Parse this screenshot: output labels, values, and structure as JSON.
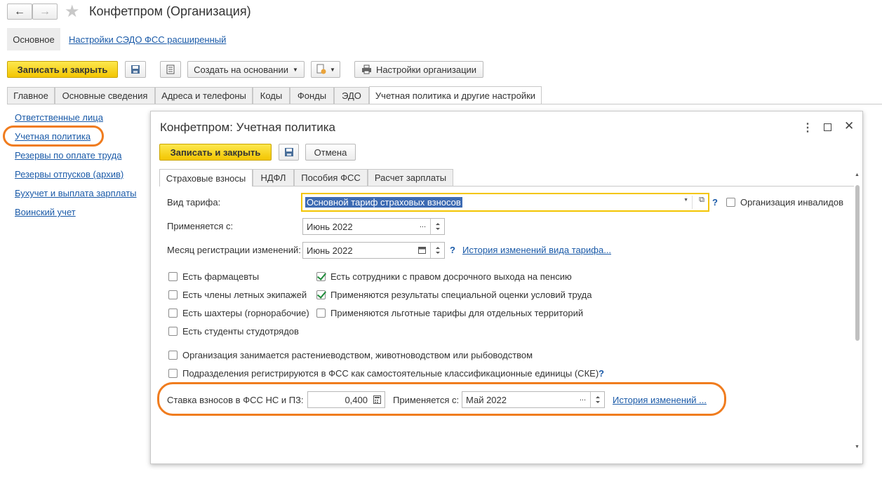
{
  "window": {
    "title": "Конфетпром (Организация)"
  },
  "top_tabs": {
    "main": "Основное",
    "link": "Настройки СЭДО ФСС расширенный"
  },
  "toolbar": {
    "save_close": "Записать и закрыть",
    "create_based": "Создать на основании",
    "org_settings": "Настройки организации"
  },
  "main_tabs": [
    "Главное",
    "Основные сведения",
    "Адреса и телефоны",
    "Коды",
    "Фонды",
    "ЭДО",
    "Учетная политика и другие настройки"
  ],
  "sidebar": [
    "Ответственные лица",
    "Учетная политика",
    "Резервы по оплате труда",
    "Резервы отпусков (архив)",
    "Бухучет и выплата зарплаты",
    "Воинский учет"
  ],
  "dialog": {
    "title": "Конфетпром: Учетная политика",
    "save_close": "Записать и закрыть",
    "cancel": "Отмена",
    "tabs": [
      "Страховые взносы",
      "НДФЛ",
      "Пособия ФСС",
      "Расчет зарплаты"
    ],
    "tariff_label": "Вид тарифа:",
    "tariff_value": "Основной тариф страховых взносов",
    "disabled_org": "Организация инвалидов",
    "applies_label": "Применяется с:",
    "applies_value": "Июнь 2022",
    "reg_month_label": "Месяц регистрации изменений:",
    "reg_month_value": "Июнь 2022",
    "history_tariff": "История изменений вида тарифа...",
    "checks_left": [
      "Есть фармацевты",
      "Есть члены летных экипажей",
      "Есть шахтеры (горнорабочие)",
      "Есть студенты студотрядов"
    ],
    "checks_right": [
      "Есть сотрудники с правом досрочного выхода на пенсию",
      "Применяются результаты специальной оценки условий труда",
      "Применяются льготные тарифы для отдельных территорий"
    ],
    "checks_right_state": [
      true,
      true,
      false
    ],
    "check_agri": "Организация занимается растениеводством, животноводством или рыбоводством",
    "check_ske": "Подразделения регистрируются в ФСС как самостоятельные классификационные единицы (СКЕ)",
    "rate_label": "Ставка взносов в ФСС НС и ПЗ:",
    "rate_value": "0,400",
    "rate_applies_label": "Применяется с:",
    "rate_applies_value": "Май 2022",
    "history": "История изменений ...",
    "help": "?"
  }
}
